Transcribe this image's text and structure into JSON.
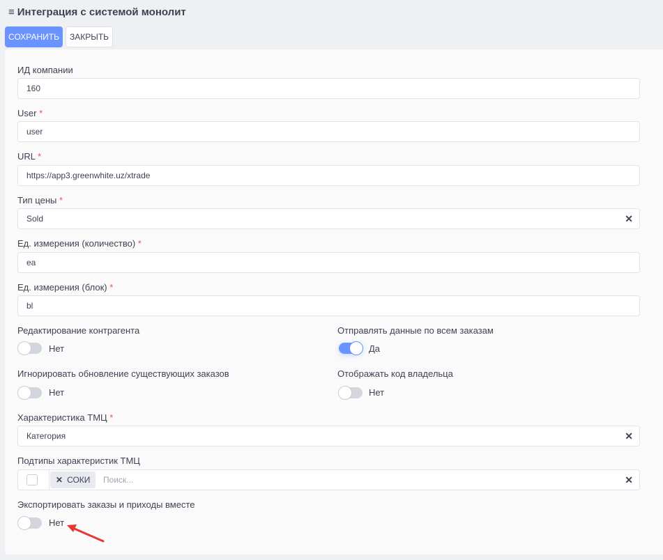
{
  "header": {
    "menu_icon": "burger-icon",
    "title": "Интеграция с системой монолит"
  },
  "toolbar": {
    "save_label": "СОХРАНИТЬ",
    "close_label": "ЗАКРЫТЬ"
  },
  "form": {
    "company_id": {
      "label": "ИД компании",
      "value": "160"
    },
    "user": {
      "label": "User",
      "required": "*",
      "value": "user"
    },
    "url": {
      "label": "URL",
      "required": "*",
      "value": "https://app3.greenwhite.uz/xtrade"
    },
    "price_type": {
      "label": "Тип цены",
      "required": "*",
      "value": "Sold"
    },
    "unit_qty": {
      "label": "Ед. измерения (количество)",
      "required": "*",
      "value": "ea"
    },
    "unit_block": {
      "label": "Ед. измерения (блок)",
      "required": "*",
      "value": "bl"
    },
    "edit_counterparty": {
      "label": "Редактирование контрагента",
      "state": "Нет",
      "on": false
    },
    "send_all_orders": {
      "label": "Отправлять данные по всем заказам",
      "state": "Да",
      "on": true
    },
    "ignore_updates": {
      "label": "Игнорировать обновление существующих заказов",
      "state": "Нет",
      "on": false
    },
    "show_owner_code": {
      "label": "Отображать код владельца",
      "state": "Нет",
      "on": false
    },
    "tmc_characteristic": {
      "label": "Характеристика ТМЦ",
      "required": "*",
      "value": "Категория"
    },
    "tmc_subtypes": {
      "label": "Подтипы характеристик ТМЦ",
      "tag": "СОКИ",
      "placeholder": "Поиск..."
    },
    "export_together": {
      "label": "Экспортировать заказы и приходы вместе",
      "state": "Нет",
      "on": false
    }
  },
  "colors": {
    "primary": "#6993ff",
    "required": "#f64e60",
    "arrow": "#e53935"
  }
}
